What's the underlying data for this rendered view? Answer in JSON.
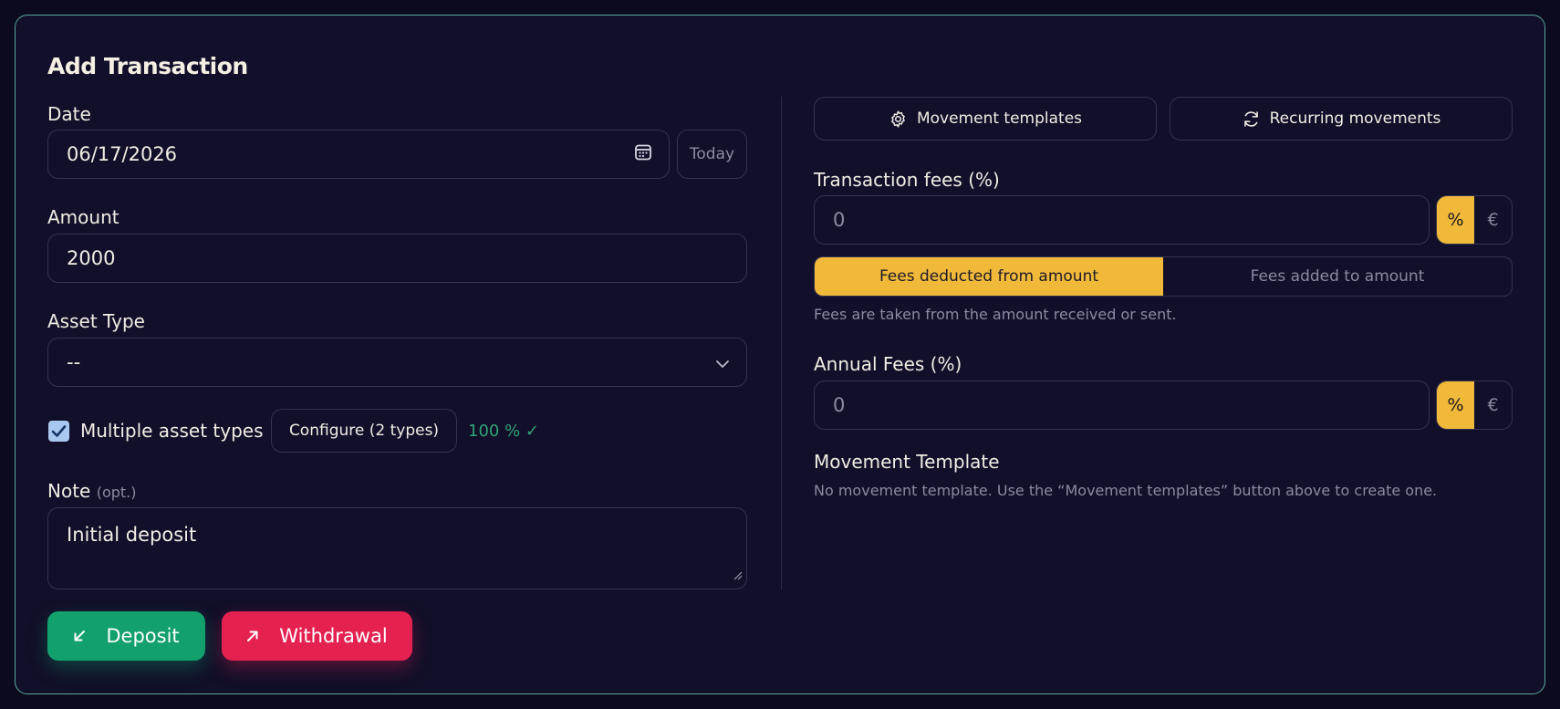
{
  "title": "Add Transaction",
  "date": {
    "label": "Date",
    "value": "06/17/2026",
    "today_label": "Today",
    "icon": "calendar-icon"
  },
  "amount": {
    "label": "Amount",
    "value": "2000"
  },
  "asset_type": {
    "label": "Asset Type",
    "selected": "--",
    "icon": "chevron-down-icon"
  },
  "multiple_assets": {
    "checked": true,
    "label": "Multiple asset types",
    "configure_label": "Configure (2 types)",
    "allocation_status": "100 % ✓"
  },
  "note": {
    "label": "Note",
    "optional_hint": "(opt.)",
    "value": "Initial deposit"
  },
  "actions": {
    "deposit_label": "Deposit",
    "withdrawal_label": "Withdrawal"
  },
  "toolbar": {
    "movement_templates_label": "Movement templates",
    "recurring_label": "Recurring movements"
  },
  "transaction_fees": {
    "label": "Transaction fees (%)",
    "value": "0",
    "unit_percent": "%",
    "unit_euro": "€",
    "mode_deducted": "Fees deducted from amount",
    "mode_added": "Fees added to amount",
    "helper": "Fees are taken from the amount received or sent."
  },
  "annual_fees": {
    "label": "Annual Fees (%)",
    "value": "0",
    "unit_percent": "%",
    "unit_euro": "€"
  },
  "movement_template": {
    "label": "Movement Template",
    "empty_text": "No movement template. Use the “Movement templates” button above to create one."
  },
  "colors": {
    "accent_yellow": "#f0b93a",
    "deposit_green": "#12a06c",
    "withdraw_red": "#e52152",
    "card_border": "#5aa896"
  }
}
